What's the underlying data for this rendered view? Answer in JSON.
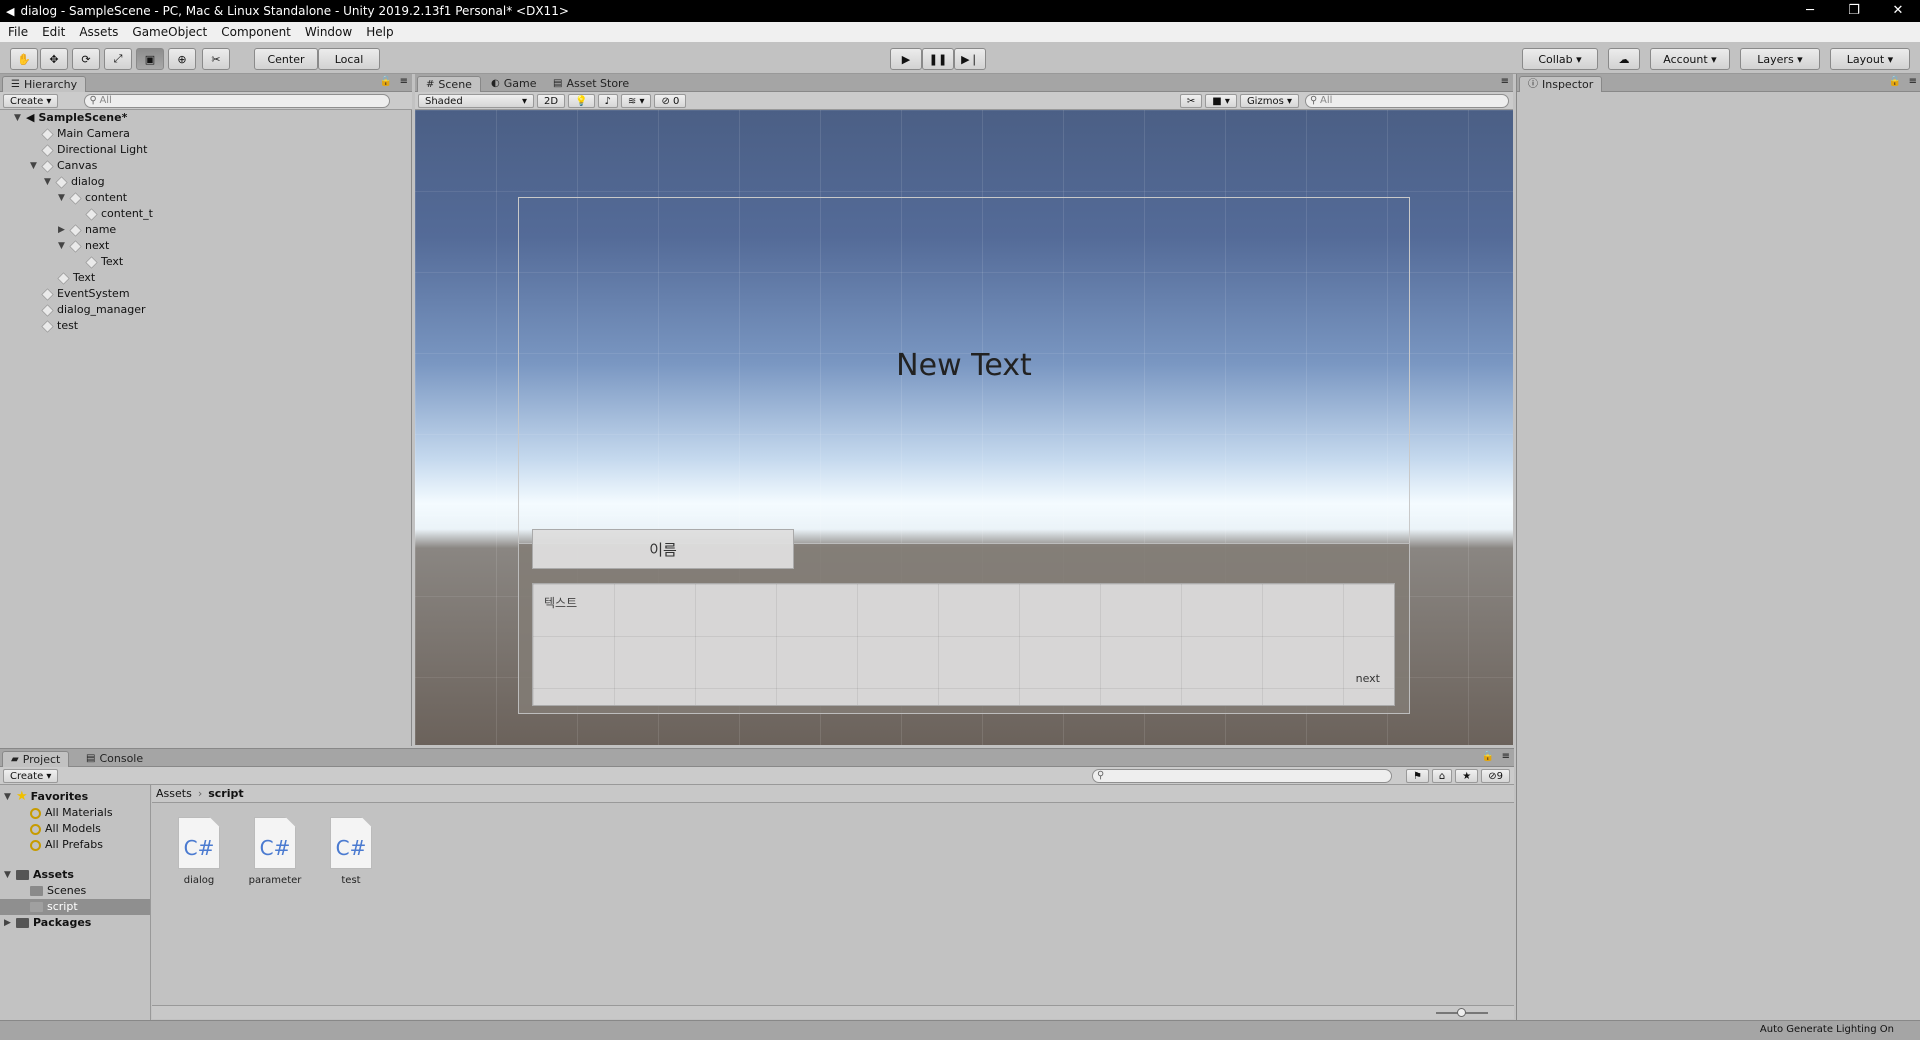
{
  "window": {
    "title": "dialog - SampleScene - PC, Mac & Linux Standalone - Unity 2019.2.13f1 Personal* <DX11>",
    "minimize": "─",
    "maximize": "❐",
    "close": "✕"
  },
  "menu": [
    "File",
    "Edit",
    "Assets",
    "GameObject",
    "Component",
    "Window",
    "Help"
  ],
  "toolbar": {
    "pivot": "Center",
    "space": "Local",
    "collab": "Collab",
    "account": "Account",
    "layers": "Layers",
    "layout": "Layout"
  },
  "hierarchy": {
    "tab": "Hierarchy",
    "create": "Create",
    "search_placeholder": "All",
    "scene_name": "SampleScene*",
    "items": [
      {
        "label": "Main Camera"
      },
      {
        "label": "Directional Light"
      },
      {
        "label": "Canvas"
      },
      {
        "label": "dialog"
      },
      {
        "label": "content"
      },
      {
        "label": "content_t"
      },
      {
        "label": "name"
      },
      {
        "label": "next"
      },
      {
        "label": "Text"
      },
      {
        "label": "Text"
      },
      {
        "label": "EventSystem"
      },
      {
        "label": "dialog_manager"
      },
      {
        "label": "test"
      }
    ]
  },
  "scene": {
    "tabs": [
      "Scene",
      "Game",
      "Asset Store"
    ],
    "shading": "Shaded",
    "mode2d": "2D",
    "hidden_count": "0",
    "gizmos": "Gizmos",
    "search_placeholder": "All",
    "ui_text": "New Text",
    "name_text": "이름",
    "content_text": "텍스트",
    "next_text": "next"
  },
  "inspector": {
    "tab": "Inspector"
  },
  "project": {
    "tabs": [
      "Project",
      "Console"
    ],
    "create": "Create",
    "filter_count": "9",
    "favorites": "Favorites",
    "fav_items": [
      "All Materials",
      "All Models",
      "All Prefabs"
    ],
    "assets": "Assets",
    "asset_folders": [
      "Scenes",
      "script"
    ],
    "packages": "Packages",
    "breadcrumb": [
      "Assets",
      "script"
    ],
    "files": [
      {
        "name": "dialog",
        "icon": "C#"
      },
      {
        "name": "parameter",
        "icon": "C#"
      },
      {
        "name": "test",
        "icon": "C#"
      }
    ]
  },
  "status": {
    "right": "Auto Generate Lighting On"
  },
  "colors": {
    "panel": "#c2c2c2",
    "header": "#a5a5a5",
    "selection": "#8f8f8f",
    "csharp": "#4a7ad0"
  }
}
